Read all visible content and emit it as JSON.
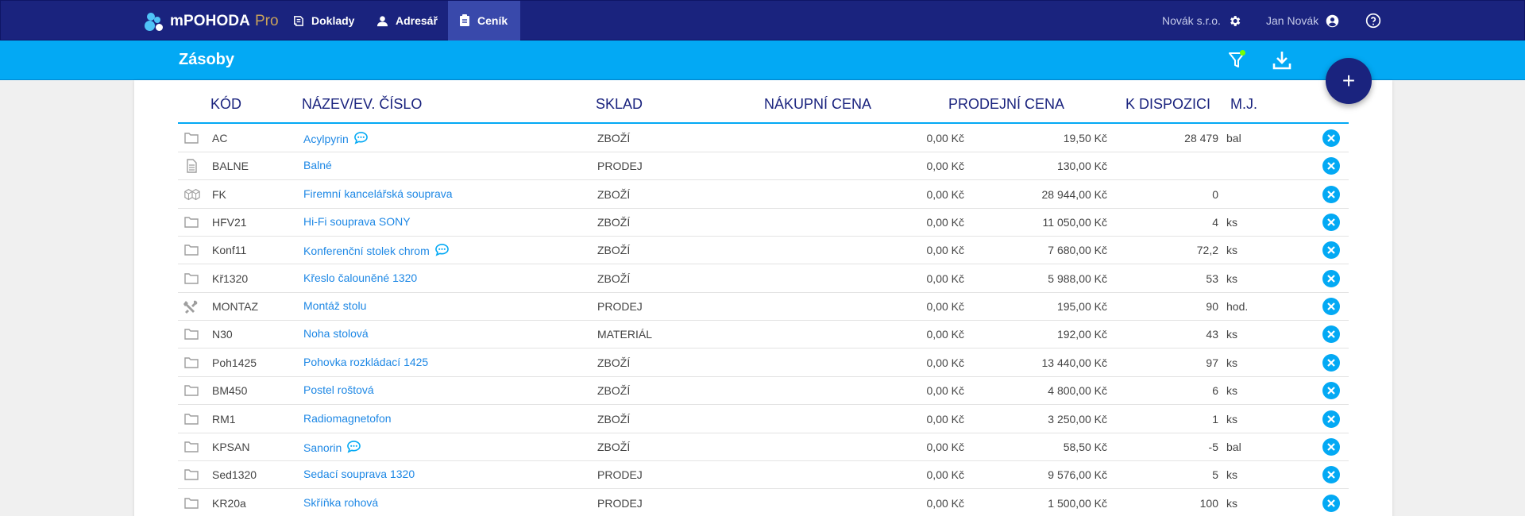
{
  "app": {
    "name": "mPOHODA",
    "edition": "Pro"
  },
  "nav": [
    {
      "label": "Doklady",
      "icon": "documents-icon"
    },
    {
      "label": "Adresář",
      "icon": "person-icon"
    },
    {
      "label": "Ceník",
      "icon": "pricelist-icon",
      "active": true
    }
  ],
  "user_area": {
    "company": "Novák s.r.o.",
    "user": "Jan Novák"
  },
  "page": {
    "title": "Zásoby"
  },
  "fab_label": "+",
  "table": {
    "columns": [
      "KÓD",
      "NÁZEV/EV. ČÍSLO",
      "SKLAD",
      "NÁKUPNÍ CENA",
      "PRODEJNÍ CENA",
      "K DISPOZICI",
      "M.J."
    ],
    "rows": [
      {
        "type": "folder",
        "code": "AC",
        "name": "Acylpyrin",
        "comment": true,
        "sklad": "ZBOŽÍ",
        "buy": "0,00 Kč",
        "sell": "19,50 Kč",
        "avail": "28 479",
        "unit": "bal"
      },
      {
        "type": "document",
        "code": "BALNE",
        "name": "Balné",
        "comment": false,
        "sklad": "PRODEJ",
        "buy": "0,00 Kč",
        "sell": "130,00 Kč",
        "avail": "",
        "unit": ""
      },
      {
        "type": "boxes",
        "code": "FK",
        "name": "Firemní kancelářská souprava",
        "comment": false,
        "sklad": "ZBOŽÍ",
        "buy": "0,00 Kč",
        "sell": "28 944,00 Kč",
        "avail": "0",
        "unit": ""
      },
      {
        "type": "folder",
        "code": "HFV21",
        "name": "Hi-Fi souprava SONY",
        "comment": false,
        "sklad": "ZBOŽÍ",
        "buy": "0,00 Kč",
        "sell": "11 050,00 Kč",
        "avail": "4",
        "unit": "ks"
      },
      {
        "type": "folder",
        "code": "Konf11",
        "name": "Konferenční stolek chrom",
        "comment": true,
        "sklad": "ZBOŽÍ",
        "buy": "0,00 Kč",
        "sell": "7 680,00 Kč",
        "avail": "72,2",
        "unit": "ks"
      },
      {
        "type": "folder",
        "code": "Kř1320",
        "name": "Křeslo čalouněné 1320",
        "comment": false,
        "sklad": "ZBOŽÍ",
        "buy": "0,00 Kč",
        "sell": "5 988,00 Kč",
        "avail": "53",
        "unit": "ks"
      },
      {
        "type": "tools",
        "code": "MONTAZ",
        "name": "Montáž stolu",
        "comment": false,
        "sklad": "PRODEJ",
        "buy": "0,00 Kč",
        "sell": "195,00 Kč",
        "avail": "90",
        "unit": "hod."
      },
      {
        "type": "folder",
        "code": "N30",
        "name": "Noha stolová",
        "comment": false,
        "sklad": "MATERIÁL",
        "buy": "0,00 Kč",
        "sell": "192,00 Kč",
        "avail": "43",
        "unit": "ks"
      },
      {
        "type": "folder",
        "code": "Poh1425",
        "name": "Pohovka rozkládací 1425",
        "comment": false,
        "sklad": "ZBOŽÍ",
        "buy": "0,00 Kč",
        "sell": "13 440,00 Kč",
        "avail": "97",
        "unit": "ks"
      },
      {
        "type": "folder",
        "code": "BM450",
        "name": "Postel roštová",
        "comment": false,
        "sklad": "ZBOŽÍ",
        "buy": "0,00 Kč",
        "sell": "4 800,00 Kč",
        "avail": "6",
        "unit": "ks"
      },
      {
        "type": "folder",
        "code": "RM1",
        "name": "Radiomagnetofon",
        "comment": false,
        "sklad": "ZBOŽÍ",
        "buy": "0,00 Kč",
        "sell": "3 250,00 Kč",
        "avail": "1",
        "unit": "ks"
      },
      {
        "type": "folder",
        "code": "KPSAN",
        "name": "Sanorin",
        "comment": true,
        "sklad": "ZBOŽÍ",
        "buy": "0,00 Kč",
        "sell": "58,50 Kč",
        "avail": "-5",
        "unit": "bal"
      },
      {
        "type": "folder",
        "code": "Sed1320",
        "name": "Sedací souprava 1320",
        "comment": false,
        "sklad": "PRODEJ",
        "buy": "0,00 Kč",
        "sell": "9 576,00 Kč",
        "avail": "5",
        "unit": "ks"
      },
      {
        "type": "folder",
        "code": "KR20a",
        "name": "Skříňka rohová",
        "comment": false,
        "sklad": "PRODEJ",
        "buy": "0,00 Kč",
        "sell": "1 500,00 Kč",
        "avail": "100",
        "unit": "ks"
      }
    ]
  },
  "colors": {
    "nav_bg": "#1a237e",
    "nav_active": "#3949ab",
    "subbar_bg": "#03a9f4",
    "link": "#1e88e5",
    "accent_dot": "#76ff03"
  }
}
